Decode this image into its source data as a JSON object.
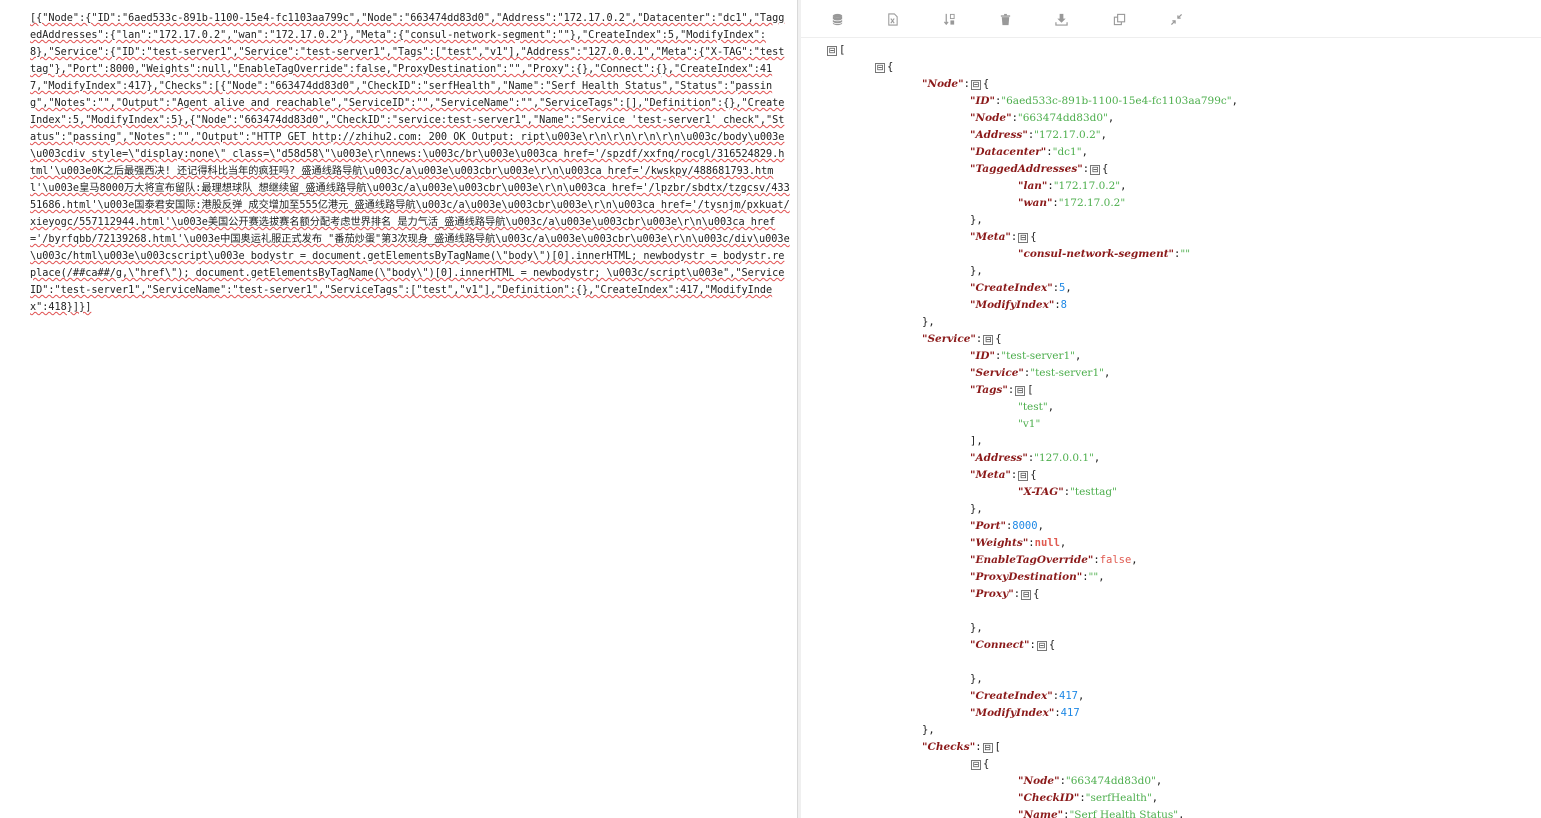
{
  "raw_text": "[{\"Node\":{\"ID\":\"6aed533c-891b-1100-15e4-fc1103aa799c\",\"Node\":\"663474dd83d0\",\"Address\":\"172.17.0.2\",\"Datacenter\":\"dc1\",\"TaggedAddresses\":{\"lan\":\"172.17.0.2\",\"wan\":\"172.17.0.2\"},\"Meta\":{\"consul-network-segment\":\"\"},\"CreateIndex\":5,\"ModifyIndex\":8},\"Service\":{\"ID\":\"test-server1\",\"Service\":\"test-server1\",\"Tags\":[\"test\",\"v1\"],\"Address\":\"127.0.0.1\",\"Meta\":{\"X-TAG\":\"testtag\"},\"Port\":8000,\"Weights\":null,\"EnableTagOverride\":false,\"ProxyDestination\":\"\",\"Proxy\":{},\"Connect\":{},\"CreateIndex\":417,\"ModifyIndex\":417},\"Checks\":[{\"Node\":\"663474dd83d0\",\"CheckID\":\"serfHealth\",\"Name\":\"Serf Health Status\",\"Status\":\"passing\",\"Notes\":\"\",\"Output\":\"Agent alive and reachable\",\"ServiceID\":\"\",\"ServiceName\":\"\",\"ServiceTags\":[],\"Definition\":{},\"CreateIndex\":5,\"ModifyIndex\":5},{\"Node\":\"663474dd83d0\",\"CheckID\":\"service:test-server1\",\"Name\":\"Service 'test-server1' check\",\"Status\":\"passing\",\"Notes\":\"\",\"Output\":\"HTTP GET http://zhihu2.com: 200 OK Output: ript\\u003e\\r\\n\\r\\n\\r\\n\\r\\n\\u003c/body\\u003e\\u003cdiv style=\\\"display:none\\\" class=\\\"d58d58\\\"\\u003e\\r\\nnews:\\u003c/br\\u003e\\u003ca href='/spzdf/xxfnq/rocgl/316524829.html'\\u003e0K之后最强西决! 还记得科比当年的疯狂吗? 盛通线路导航\\u003c/a\\u003e\\u003cbr\\u003e\\r\\n\\u003ca href='/kwskpy/488681793.html'\\u003e皇马8000万大将宣布留队:最理想球队 想继续留_盛通线路导航\\u003c/a\\u003e\\u003cbr\\u003e\\r\\n\\u003ca href='/lpzbr/sbdtx/tzgcsv/43351686.html'\\u003e国泰君安国际:港股反弹 成交增加至555亿港元_盛通线路导航\\u003c/a\\u003e\\u003cbr\\u003e\\r\\n\\u003ca href='/tysnjm/pxkuat/xieyogc/557112944.html'\\u003e美国公开赛选拔赛名额分配考虑世界排名 是力气活_盛通线路导航\\u003c/a\\u003e\\u003cbr\\u003e\\r\\n\\u003ca href='/byrfqbb/72139268.html'\\u003e中国奥运礼服正式发布 \"番茄炒蛋\"第3次现身_盛通线路导航\\u003c/a\\u003e\\u003cbr\\u003e\\r\\n\\u003c/div\\u003e\\u003c/html\\u003e\\u003cscript\\u003e bodystr = document.getElementsByTagName(\\\"body\\\")[0].innerHTML; newbodystr = bodystr.replace(/##ca##/g,\\\"href\\\"); document.getElementsByTagName(\\\"body\\\")[0].innerHTML = newbodystr; \\u003c/script\\u003e\",\"ServiceID\":\"test-server1\",\"ServiceName\":\"test-server1\",\"ServiceTags\":[\"test\",\"v1\"],\"Definition\":{},\"CreateIndex\":417,\"ModifyIndex\":418}]}]",
  "toolbar": {
    "icons": [
      "database-icon",
      "excel-icon",
      "sort-icon",
      "trash-icon",
      "download-icon",
      "copy-icon",
      "compress-icon"
    ]
  },
  "toggle_glyph": "⊟",
  "tree_lines": [
    {
      "i": 0,
      "t": "[",
      "tg": true
    },
    {
      "i": 1,
      "t": "{",
      "tg": true
    },
    {
      "i": 2,
      "k": "Node",
      "t": "{",
      "tg": true
    },
    {
      "i": 3,
      "k": "ID",
      "v": "6aed533c-891b-1100-15e4-fc1103aa799c",
      "vt": "s",
      "c": ","
    },
    {
      "i": 3,
      "k": "Node",
      "v": "663474dd83d0",
      "vt": "s",
      "c": ","
    },
    {
      "i": 3,
      "k": "Address",
      "v": "172.17.0.2",
      "vt": "s",
      "c": ","
    },
    {
      "i": 3,
      "k": "Datacenter",
      "v": "dc1",
      "vt": "s",
      "c": ","
    },
    {
      "i": 3,
      "k": "TaggedAddresses",
      "t": "{",
      "tg": true
    },
    {
      "i": 4,
      "k": "lan",
      "v": "172.17.0.2",
      "vt": "s",
      "c": ","
    },
    {
      "i": 4,
      "k": "wan",
      "v": "172.17.0.2",
      "vt": "s"
    },
    {
      "i": 3,
      "t": "},"
    },
    {
      "i": 3,
      "k": "Meta",
      "t": "{",
      "tg": true
    },
    {
      "i": 4,
      "k": "consul-network-segment",
      "v": "",
      "vt": "s"
    },
    {
      "i": 3,
      "t": "},"
    },
    {
      "i": 3,
      "k": "CreateIndex",
      "v": "5",
      "vt": "n",
      "c": ","
    },
    {
      "i": 3,
      "k": "ModifyIndex",
      "v": "8",
      "vt": "n"
    },
    {
      "i": 2,
      "t": "},"
    },
    {
      "i": 2,
      "k": "Service",
      "t": "{",
      "tg": true
    },
    {
      "i": 3,
      "k": "ID",
      "v": "test-server1",
      "vt": "s",
      "c": ","
    },
    {
      "i": 3,
      "k": "Service",
      "v": "test-server1",
      "vt": "s",
      "c": ","
    },
    {
      "i": 3,
      "k": "Tags",
      "t": "[",
      "tg": true
    },
    {
      "i": 4,
      "v": "test",
      "vt": "s",
      "c": ","
    },
    {
      "i": 4,
      "v": "v1",
      "vt": "s"
    },
    {
      "i": 3,
      "t": "],"
    },
    {
      "i": 3,
      "k": "Address",
      "v": "127.0.0.1",
      "vt": "s",
      "c": ","
    },
    {
      "i": 3,
      "k": "Meta",
      "t": "{",
      "tg": true
    },
    {
      "i": 4,
      "k": "X-TAG",
      "v": "testtag",
      "vt": "s"
    },
    {
      "i": 3,
      "t": "},"
    },
    {
      "i": 3,
      "k": "Port",
      "v": "8000",
      "vt": "n",
      "c": ","
    },
    {
      "i": 3,
      "k": "Weights",
      "v": "null",
      "vt": "nl",
      "c": ","
    },
    {
      "i": 3,
      "k": "EnableTagOverride",
      "v": "false",
      "vt": "b",
      "c": ","
    },
    {
      "i": 3,
      "k": "ProxyDestination",
      "v": "",
      "vt": "s",
      "c": ","
    },
    {
      "i": 3,
      "k": "Proxy",
      "t": "{",
      "tg": true
    },
    {
      "i": 3,
      "t": ""
    },
    {
      "i": 3,
      "t": "},"
    },
    {
      "i": 3,
      "k": "Connect",
      "t": "{",
      "tg": true
    },
    {
      "i": 3,
      "t": ""
    },
    {
      "i": 3,
      "t": "},"
    },
    {
      "i": 3,
      "k": "CreateIndex",
      "v": "417",
      "vt": "n",
      "c": ","
    },
    {
      "i": 3,
      "k": "ModifyIndex",
      "v": "417",
      "vt": "n"
    },
    {
      "i": 2,
      "t": "},"
    },
    {
      "i": 2,
      "k": "Checks",
      "t": "[",
      "tg": true
    },
    {
      "i": 3,
      "t": "{",
      "tg": true
    },
    {
      "i": 4,
      "k": "Node",
      "v": "663474dd83d0",
      "vt": "s",
      "c": ","
    },
    {
      "i": 4,
      "k": "CheckID",
      "v": "serfHealth",
      "vt": "s",
      "c": ","
    },
    {
      "i": 4,
      "k": "Name",
      "v": "Serf Health Status",
      "vt": "s",
      "c": ","
    }
  ]
}
